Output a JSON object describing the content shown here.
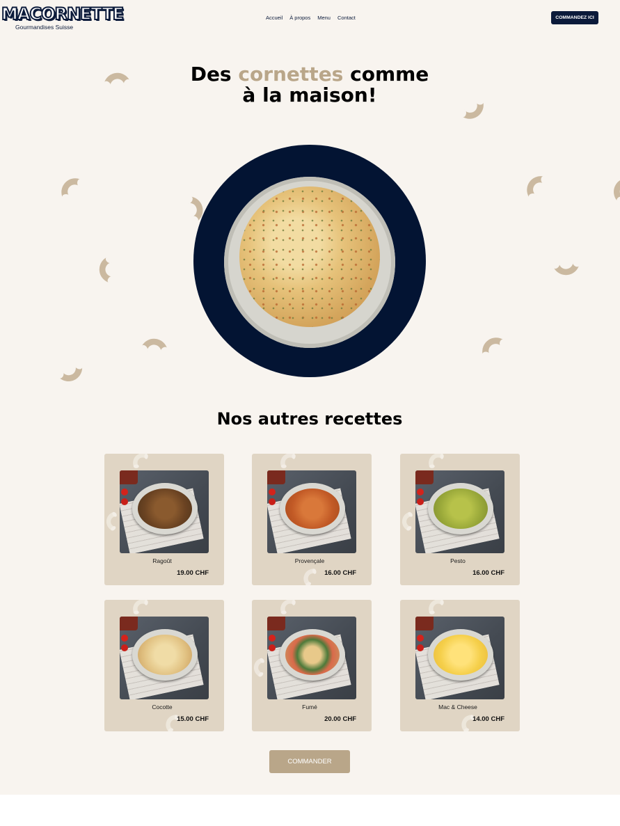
{
  "brand": {
    "name": "MACORNETTE",
    "tagline": "Gourmandises Suisse"
  },
  "nav": {
    "items": [
      "Accueil",
      "À propos",
      "Menu",
      "Contact"
    ]
  },
  "header": {
    "cta_label": "COMMANDEZ ICI"
  },
  "hero": {
    "title_before": "Des",
    "title_accent": "cornettes",
    "title_after": "comme",
    "title_line2": "à la maison!"
  },
  "recipes": {
    "title": "Nos autres recettes",
    "items": [
      {
        "name": "Ragoût",
        "price": "19.00 CHF"
      },
      {
        "name": "Provençale",
        "price": "16.00 CHF"
      },
      {
        "name": "Pesto",
        "price": "16.00 CHF"
      },
      {
        "name": "Cocotte",
        "price": "15.00 CHF"
      },
      {
        "name": "Fumé",
        "price": "20.00 CHF"
      },
      {
        "name": "Mac & Cheese",
        "price": "14.00 CHF"
      }
    ]
  },
  "footer_cta": {
    "label": "COMMANDER"
  },
  "colors": {
    "navy": "#0b1a3a",
    "beige": "#b9a689",
    "card": "#e0d5c4",
    "background": "#f8f4ef"
  }
}
